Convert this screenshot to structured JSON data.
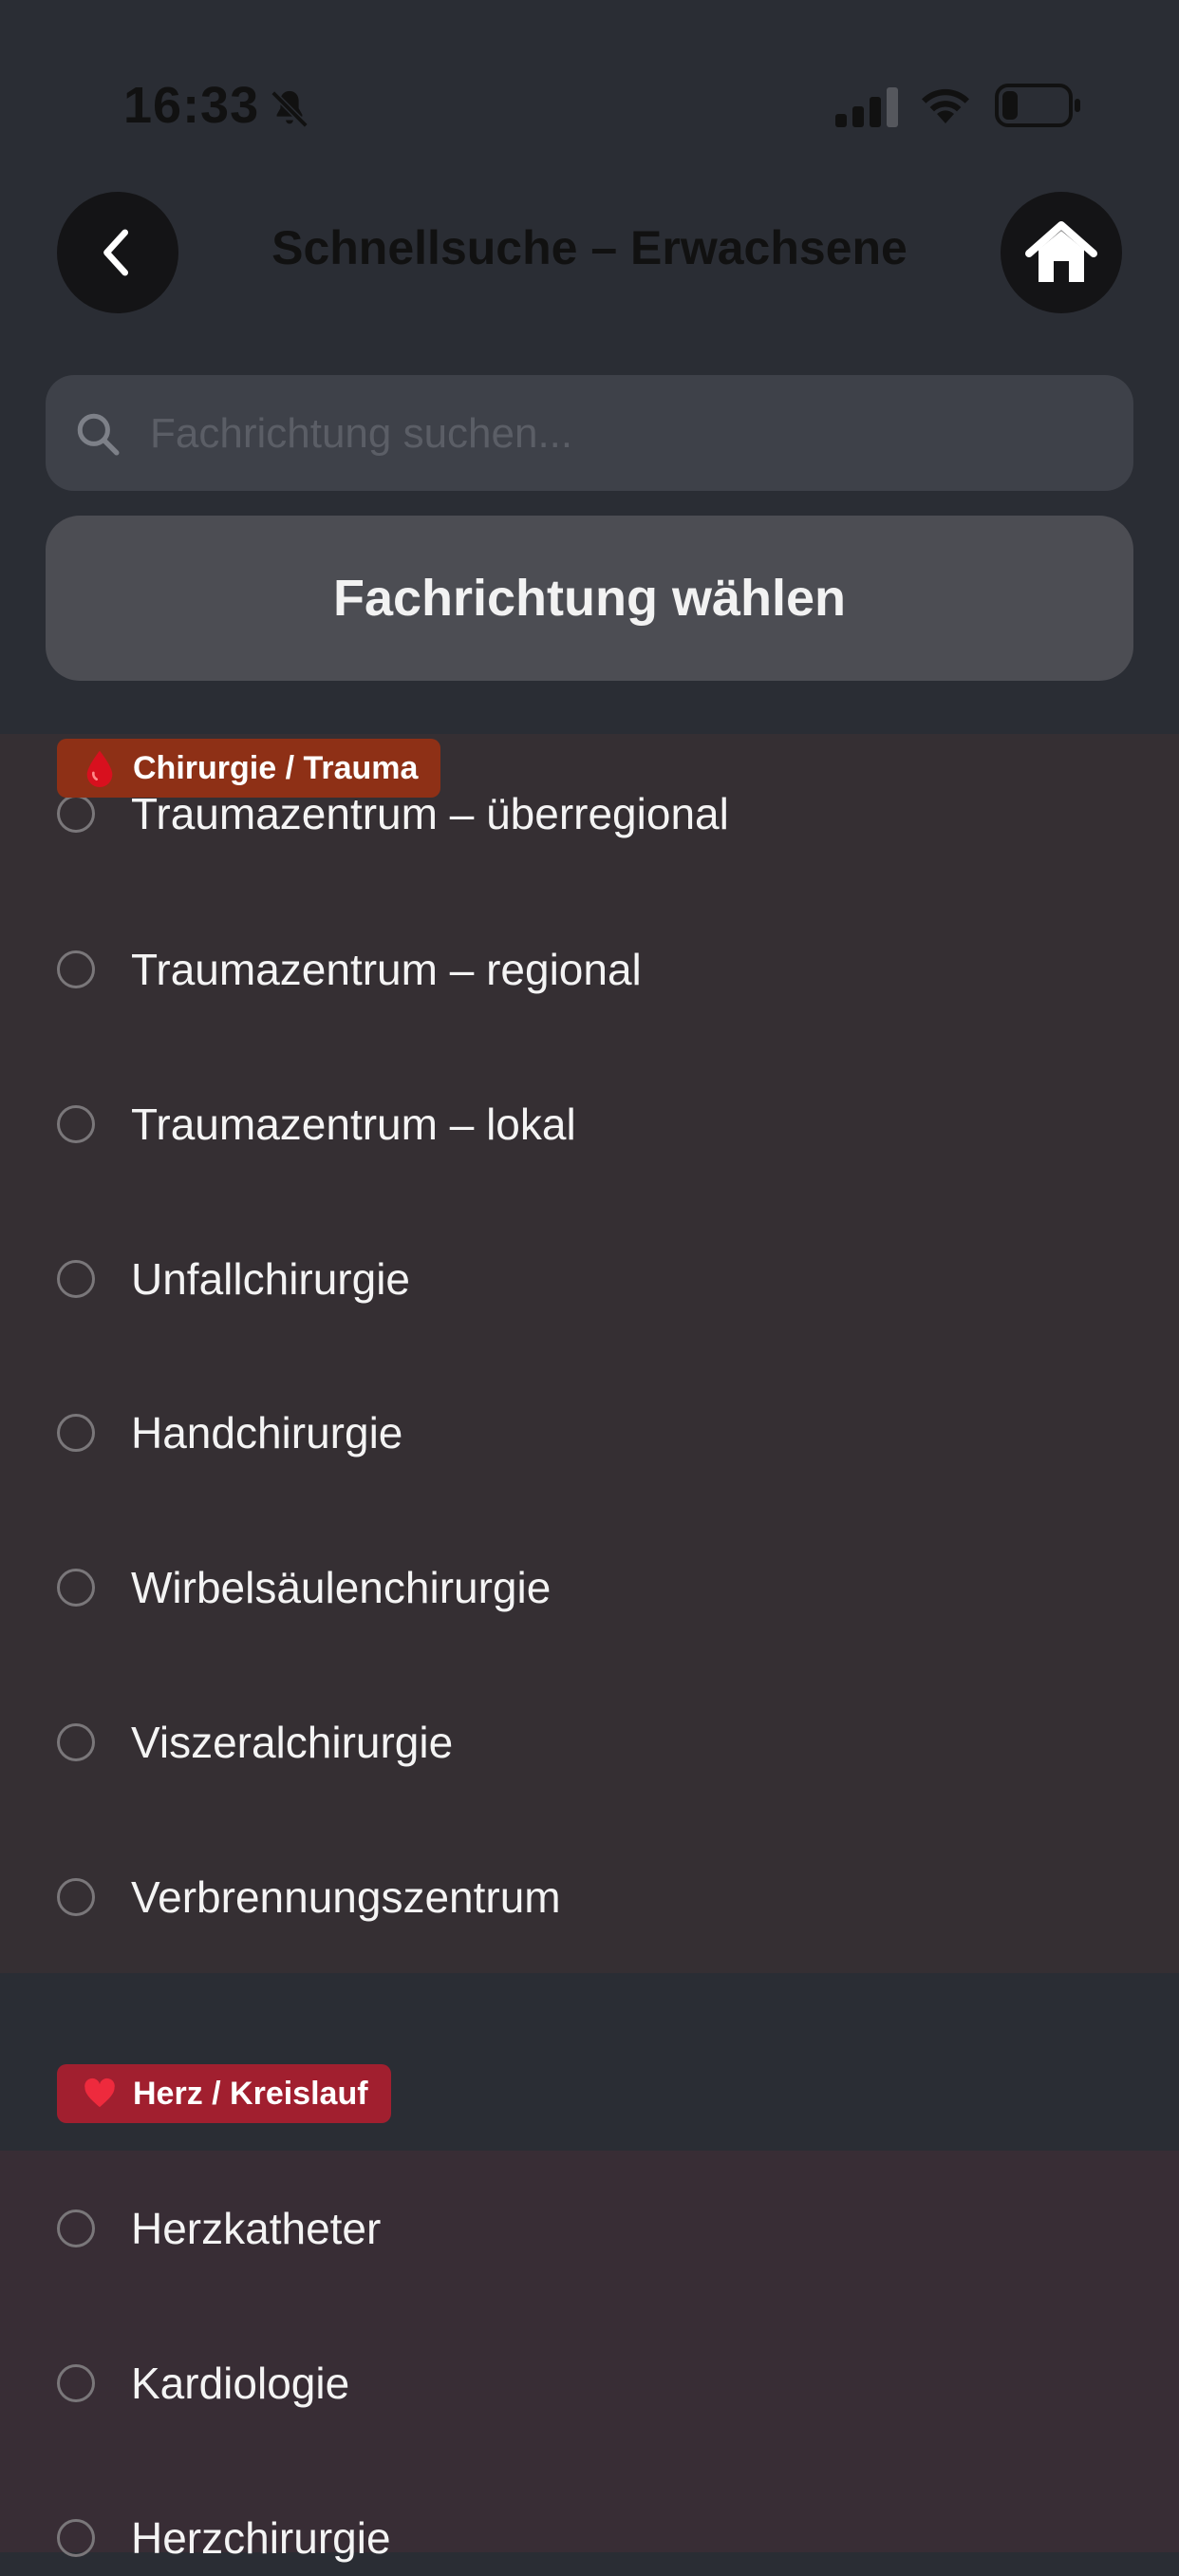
{
  "status_bar": {
    "time": "16:33",
    "icons": [
      "bell-slash-icon",
      "cellular-signal-icon",
      "wifi-icon",
      "battery-icon"
    ]
  },
  "header": {
    "title": "Schnellsuche – Erwachsene",
    "back_icon": "chevron-left-icon",
    "home_icon": "home-icon"
  },
  "search": {
    "placeholder": "Fachrichtung suchen...",
    "value": ""
  },
  "select_button": {
    "label": "Fachrichtung wählen"
  },
  "sections": [
    {
      "badge": "Chirurgie / Trauma",
      "badge_icon": "blood-drop-icon",
      "badge_color": "#8e3016",
      "items": [
        "Traumazentrum – überregional",
        "Traumazentrum – regional",
        "Traumazentrum – lokal",
        "Unfallchirurgie",
        "Handchirurgie",
        "Wirbelsäulenchirurgie",
        "Viszeralchirurgie",
        "Verbrennungszentrum"
      ]
    },
    {
      "badge": "Herz / Kreislauf",
      "badge_icon": "heart-icon",
      "badge_color": "#a11f2f",
      "items": [
        "Herzkatheter",
        "Kardiologie",
        "Herzchirurgie"
      ]
    }
  ],
  "colors": {
    "background": "#2a2d34",
    "section_1_bg": "#352f33",
    "section_2_bg": "#382d35",
    "select_button_bg": "#4c4d53",
    "search_bg": "#3e4149"
  }
}
